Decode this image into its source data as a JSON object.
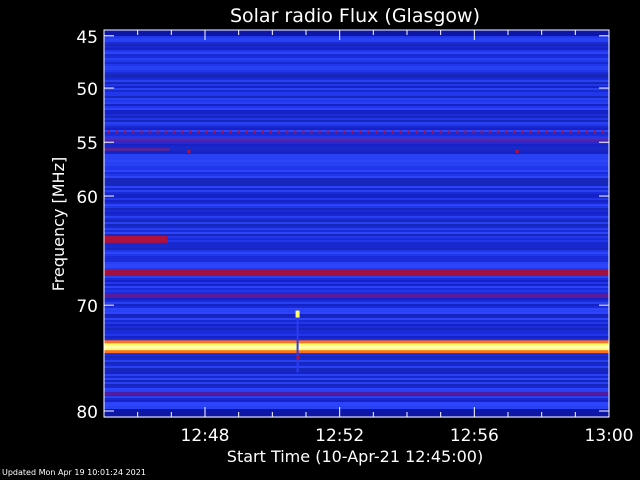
{
  "chart_data": {
    "type": "heatmap",
    "title": "Solar radio Flux (Glasgow)",
    "xlabel": "Start Time (10-Apr-21 12:45:00)",
    "ylabel": "Frequency [MHz]",
    "x_tick_labels": [
      "12:48",
      "12:52",
      "12:56",
      "13:00"
    ],
    "x_ticks_minutes": [
      3,
      7,
      11,
      15
    ],
    "xlim_minutes": [
      0,
      15
    ],
    "y_tick_labels": [
      "45",
      "50",
      "55",
      "60",
      "70",
      "80"
    ],
    "y_ticks_mhz": [
      45,
      50,
      55,
      60,
      70,
      80
    ],
    "colors": {
      "background": "#000000",
      "base_band": "#1c2fe0",
      "dark_band": "#0e16a8",
      "light_band": "#3a52ff",
      "red_band": "#b0103c",
      "hot": "#ffff60",
      "hot_edge": "#ff7020"
    },
    "bands": [
      {
        "from_y": 0.265,
        "to_y": 0.292,
        "color": "#b0103c",
        "intensity": "high",
        "dotted": true
      },
      {
        "from_y": 0.303,
        "to_y": 0.312,
        "color": "#1b28c8",
        "intensity": "medium"
      },
      {
        "from_y": 0.532,
        "to_y": 0.55,
        "color": "#b0103c",
        "intensity": "high",
        "x_to": 0.125
      },
      {
        "from_y": 0.619,
        "to_y": 0.635,
        "color": "#a01040",
        "intensity": "high"
      },
      {
        "from_y": 0.682,
        "to_y": 0.692,
        "color": "#5a1a9a",
        "intensity": "medium"
      },
      {
        "from_y": 0.807,
        "to_y": 0.83,
        "color": "#ffff60",
        "intensity": "very high"
      },
      {
        "from_y": 0.936,
        "to_y": 0.944,
        "color": "#5a1a9a",
        "intensity": "low"
      }
    ],
    "burst": {
      "x_minutes": 5.75,
      "y_from": 0.74,
      "y_to": 0.885
    }
  },
  "footer": {
    "updated": "Updated Mon Apr 19 10:01:24 2021"
  }
}
